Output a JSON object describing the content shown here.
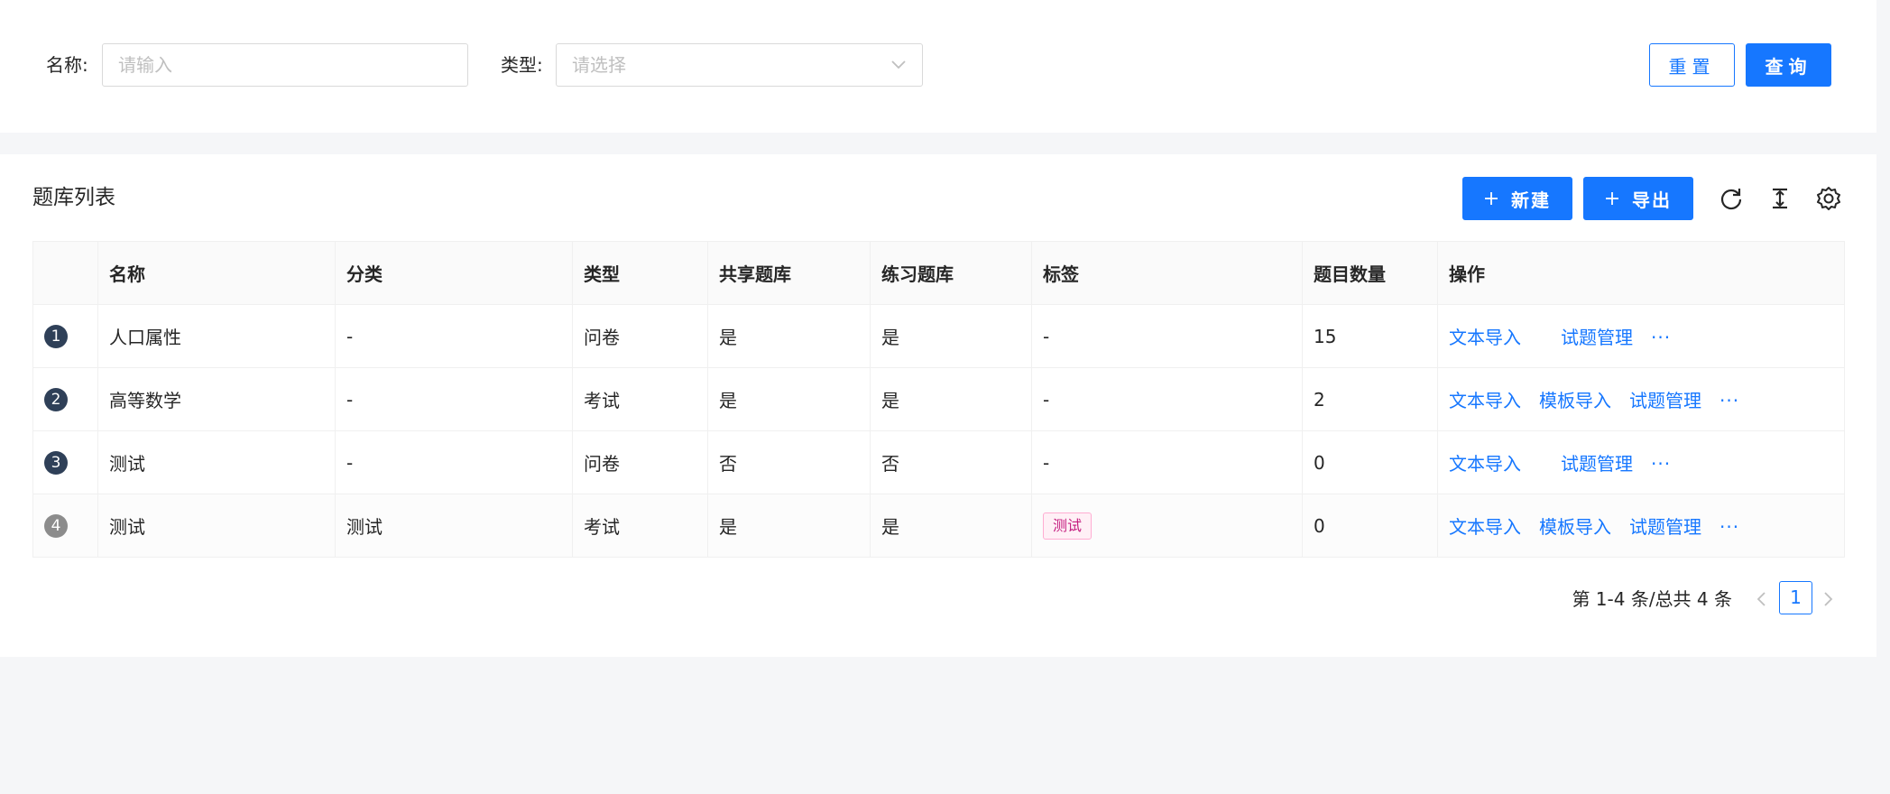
{
  "search": {
    "name_label": "名称:",
    "name_placeholder": "请输入",
    "type_label": "类型:",
    "type_placeholder": "请选择",
    "reset_label": "重置",
    "query_label": "查询"
  },
  "list": {
    "title": "题库列表",
    "new_label": "新建",
    "export_label": "导出",
    "icons": [
      "reload-icon",
      "column-height-icon",
      "setting-icon"
    ]
  },
  "table": {
    "columns": [
      "",
      "名称",
      "分类",
      "类型",
      "共享题库",
      "练习题库",
      "标签",
      "题目数量",
      "操作"
    ],
    "rows": [
      {
        "index": "1",
        "name": "人口属性",
        "category": "-",
        "type": "问卷",
        "shared": "是",
        "practice": "是",
        "tag": "-",
        "count": "15",
        "actions": {
          "text_import": "文本导入",
          "question_manage": "试题管理",
          "more": "···"
        }
      },
      {
        "index": "2",
        "name": "高等数学",
        "category": "-",
        "type": "考试",
        "shared": "是",
        "practice": "是",
        "tag": "-",
        "count": "2",
        "actions": {
          "text_import": "文本导入",
          "template_import": "模板导入",
          "question_manage": "试题管理",
          "more": "···"
        }
      },
      {
        "index": "3",
        "name": "测试",
        "category": "-",
        "type": "问卷",
        "shared": "否",
        "practice": "否",
        "tag": "-",
        "count": "0",
        "actions": {
          "text_import": "文本导入",
          "question_manage": "试题管理",
          "more": "···"
        }
      },
      {
        "index": "4",
        "name": "测试",
        "category": "测试",
        "type": "考试",
        "shared": "是",
        "practice": "是",
        "tag": "测试",
        "count": "0",
        "actions": {
          "text_import": "文本导入",
          "template_import": "模板导入",
          "question_manage": "试题管理",
          "more": "···"
        }
      }
    ]
  },
  "pagination": {
    "summary": "第 1-4 条/总共 4 条",
    "current_page": "1"
  },
  "colors": {
    "primary": "#1677ff",
    "index_badge": "#2f4058",
    "index_badge_last": "#8c8c8c",
    "tag_text": "#c41d7f",
    "tag_bg": "#fff0f6",
    "tag_border": "#ffadd2"
  }
}
